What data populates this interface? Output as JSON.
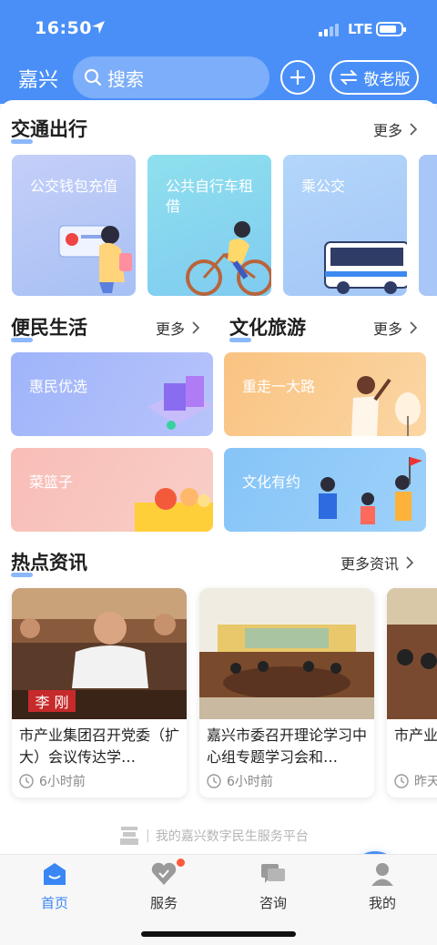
{
  "status_bar": {
    "time": "16:50",
    "network": "LTE"
  },
  "header": {
    "city": "嘉兴",
    "search_placeholder": "搜索",
    "elder_mode_label": "敬老版"
  },
  "traffic": {
    "title": "交通出行",
    "more": "更多",
    "cards": [
      {
        "label": "公交钱包充值",
        "color": "#b7c8f7"
      },
      {
        "label": "公共自行车租借",
        "color": "#8fdcf0"
      },
      {
        "label": "乘公交",
        "color": "#a9cdfa"
      }
    ]
  },
  "life": {
    "title": "便民生活",
    "more": "更多",
    "cards": [
      {
        "label": "惠民优选",
        "color": "#9fb3f9"
      },
      {
        "label": "菜篮子",
        "color": "#f7b5b0"
      }
    ]
  },
  "culture": {
    "title": "文化旅游",
    "more": "更多",
    "cards": [
      {
        "label": "重走一大路",
        "color": "#f8c98c"
      },
      {
        "label": "文化有约",
        "color": "#8ec8f8"
      }
    ]
  },
  "news": {
    "title": "热点资讯",
    "more": "更多资讯",
    "items": [
      {
        "title": "市产业集团召开党委（扩大）会议传达学…",
        "time": "6小时前",
        "name_caption": "李 刚"
      },
      {
        "title": "嘉兴市委召开理论学习中心组专题学习会和…",
        "time": "6小时前"
      },
      {
        "title": "市产业…举办工…",
        "time": "昨天"
      }
    ]
  },
  "slogan": "我的嘉兴数字民生服务平台",
  "tabbar": [
    {
      "label": "首页",
      "icon": "home-icon",
      "active": true
    },
    {
      "label": "服务",
      "icon": "heart-icon",
      "active": false,
      "badge": true
    },
    {
      "label": "咨询",
      "icon": "chat-icon",
      "active": false
    },
    {
      "label": "我的",
      "icon": "profile-icon",
      "active": false
    }
  ],
  "colors": {
    "primary": "#4a8ff7",
    "badge": "#ff5a3c"
  }
}
